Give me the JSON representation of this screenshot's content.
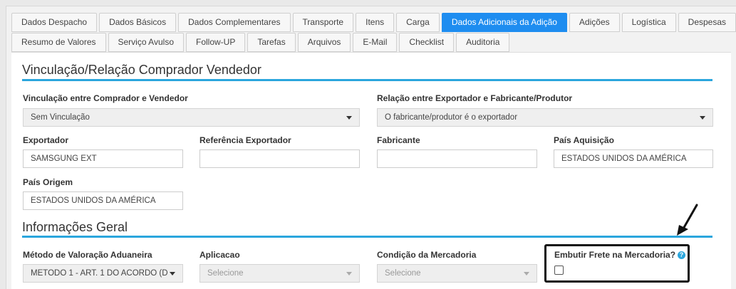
{
  "tabs": {
    "row1": [
      "Dados Despacho",
      "Dados Básicos",
      "Dados Complementares",
      "Transporte",
      "Itens",
      "Carga",
      "Dados Adicionais da Adição",
      "Adições",
      "Logística",
      "Despesas"
    ],
    "row2": [
      "Resumo de Valores",
      "Serviço Avulso",
      "Follow-UP",
      "Tarefas",
      "Arquivos",
      "E-Mail",
      "Checklist",
      "Auditoria"
    ],
    "active": "Dados Adicionais da Adição"
  },
  "section1": {
    "title": "Vinculação/Relação Comprador Vendedor",
    "vinculacao_label": "Vinculação entre Comprador e Vendedor",
    "vinculacao_value": "Sem Vinculação",
    "relacao_label": "Relação entre Exportador e Fabricante/Produtor",
    "relacao_value": "O fabricante/produtor é o exportador",
    "exportador_label": "Exportador",
    "exportador_value": "SAMSGUNG EXT",
    "ref_exportador_label": "Referência Exportador",
    "ref_exportador_value": "",
    "fabricante_label": "Fabricante",
    "fabricante_value": "",
    "pais_aquisicao_label": "País Aquisição",
    "pais_aquisicao_value": "ESTADOS UNIDOS DA AMÉRICA",
    "pais_origem_label": "País Origem",
    "pais_origem_value": "ESTADOS UNIDOS DA AMÉRICA"
  },
  "section2": {
    "title": "Informações Geral",
    "metodo_label": "Método de Valoração Aduaneira",
    "metodo_value": "METODO 1 - ART. 1 DO ACORDO (D",
    "aplicacao_label": "Aplicacao",
    "aplicacao_value": "Selecione",
    "condicao_label": "Condição da Mercadoria",
    "condicao_value": "Selecione",
    "embutir_label": "Embutir Frete na Mercadoria?",
    "embutir_help": "?",
    "embutir_checked": false
  },
  "colors": {
    "accent": "#1e8df0",
    "section_line": "#2ba6dd"
  }
}
